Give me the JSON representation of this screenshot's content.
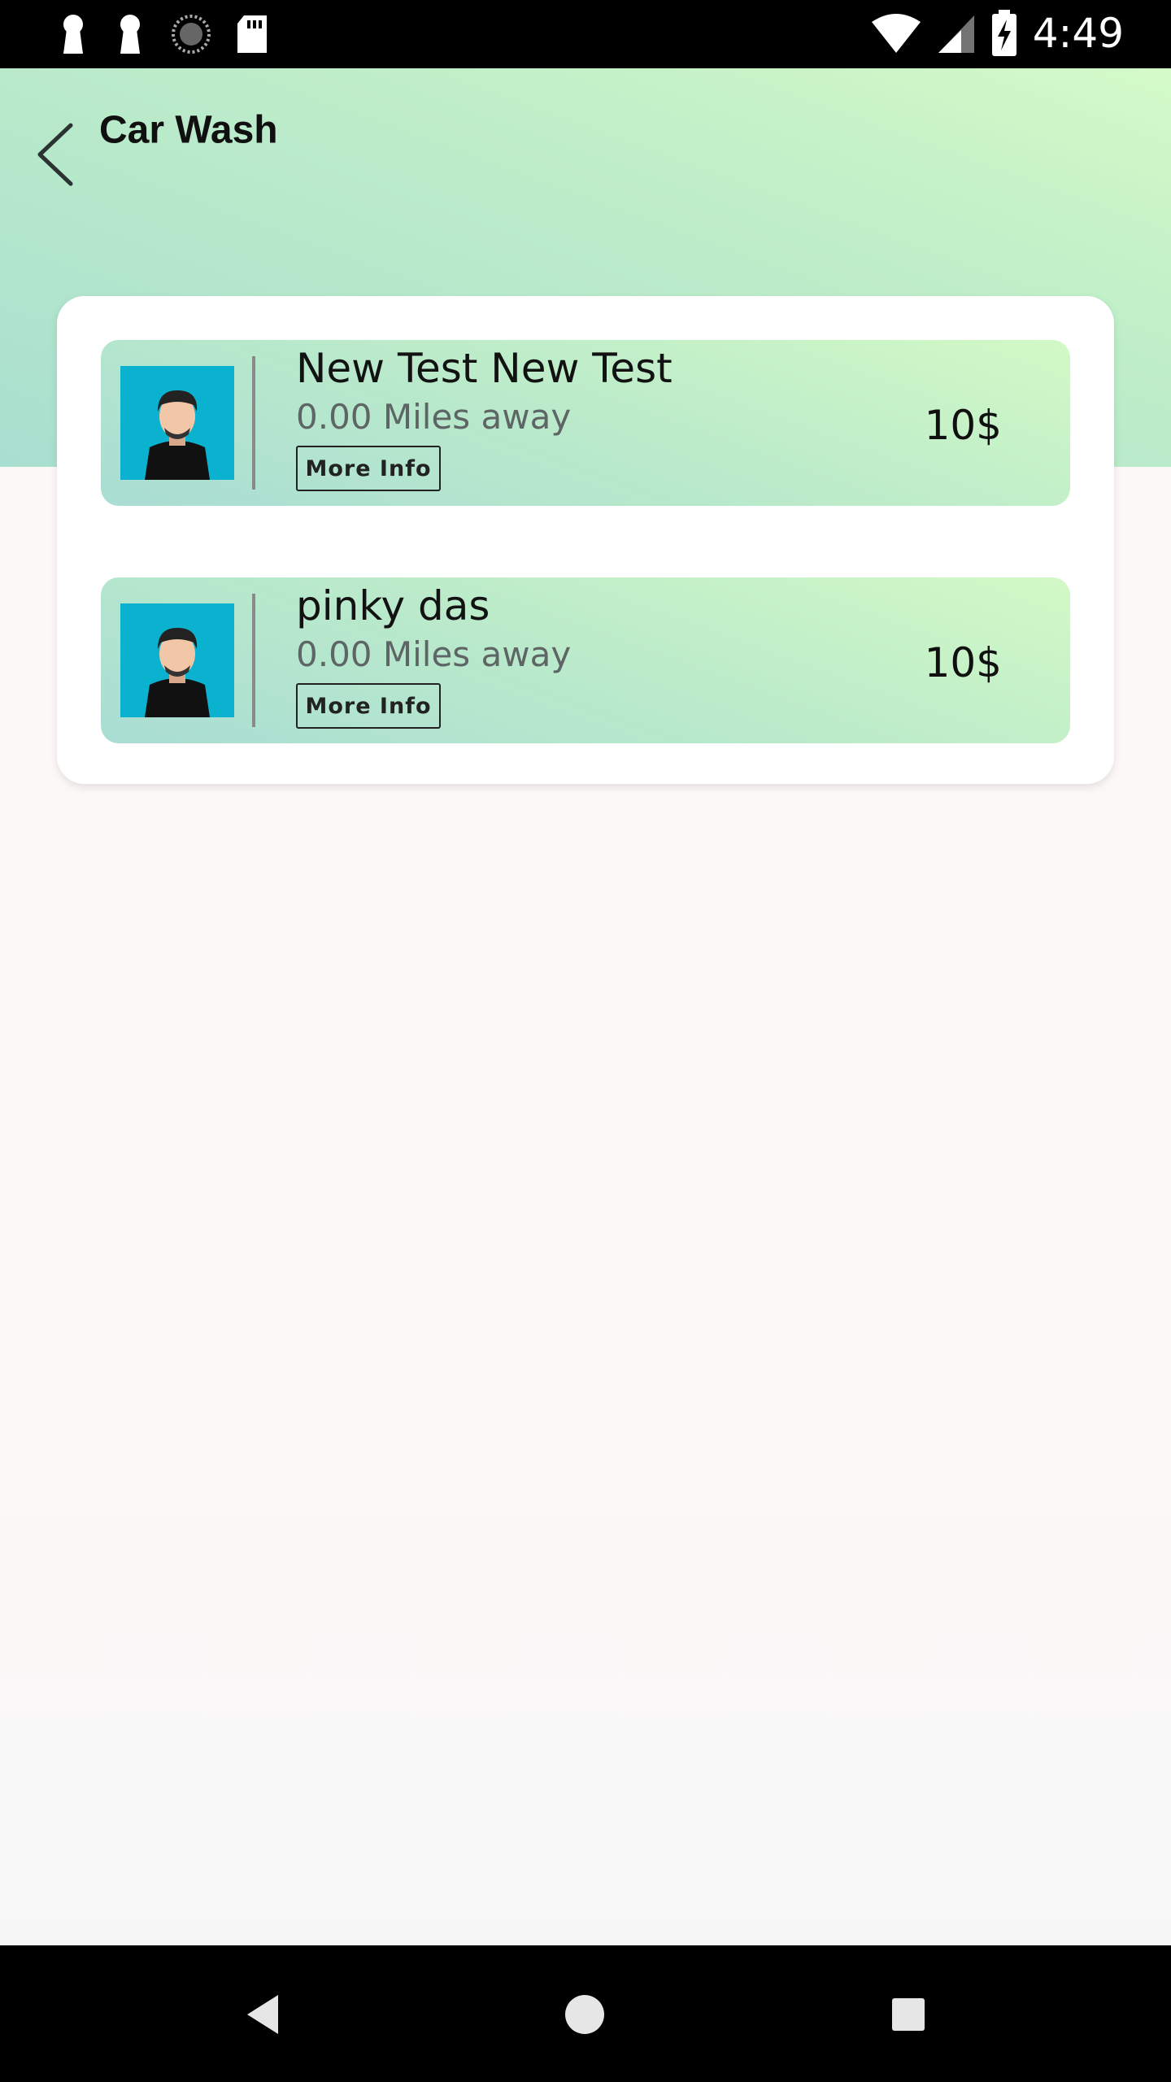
{
  "status_bar": {
    "time": "4:49",
    "icons_left": [
      "keyhole-icon",
      "keyhole-icon",
      "sync-icon",
      "sd-card-icon"
    ],
    "icons_right": [
      "wifi-icon",
      "cell-signal-icon",
      "battery-charging-icon"
    ]
  },
  "header": {
    "title": "Car Wash",
    "back_icon": "chevron-left-icon"
  },
  "providers": [
    {
      "name": "New Test New Test",
      "distance": "0.00 Miles away",
      "more_info_label": "More Info",
      "price": "10$",
      "avatar_icon": "person-avatar-icon"
    },
    {
      "name": "pinky das",
      "distance": "0.00 Miles away",
      "more_info_label": "More Info",
      "price": "10$",
      "avatar_icon": "person-avatar-icon"
    }
  ],
  "nav_bar": {
    "icons": [
      "back-triangle-icon",
      "home-circle-icon",
      "recents-square-icon"
    ]
  },
  "colors": {
    "header_gradient_start": "#d4fac8",
    "header_gradient_end": "#a9dfd0",
    "avatar_bg": "#0ab2cf",
    "page_bg": "#fcf8f6"
  }
}
